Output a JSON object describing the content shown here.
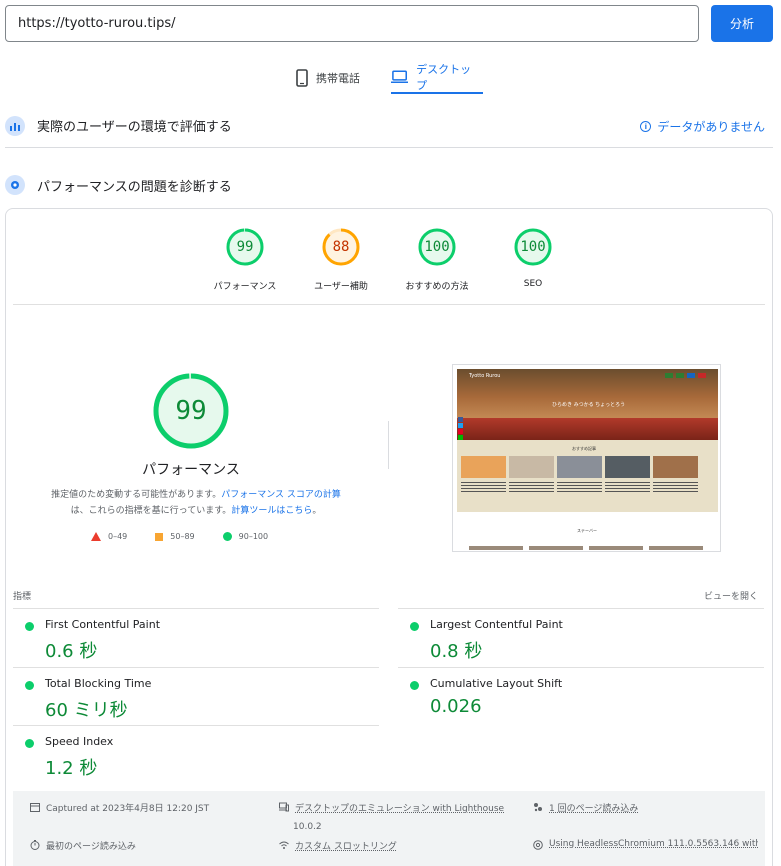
{
  "search": {
    "url": "https://tyotto-rurou.tips/",
    "analyze_label": "分析"
  },
  "tabs": {
    "mobile": "携帯電話",
    "desktop": "デスクトップ"
  },
  "field_data": {
    "title": "実際のユーザーの環境で評価する",
    "no_data": "データがありません"
  },
  "diagnose": {
    "title": "パフォーマンスの問題を診断する"
  },
  "scores": [
    {
      "label": "パフォーマンス",
      "value": "99",
      "fraction": 0.99,
      "color": "#0cce6b"
    },
    {
      "label": "ユーザー補助",
      "value": "88",
      "fraction": 0.88,
      "color": "#ffa400"
    },
    {
      "label": "おすすめの方法",
      "value": "100",
      "fraction": 1.0,
      "color": "#0cce6b"
    },
    {
      "label": "SEO",
      "value": "100",
      "fraction": 1.0,
      "color": "#0cce6b"
    }
  ],
  "performance": {
    "score": "99",
    "title": "パフォーマンス",
    "desc_1": "推定値のため変動する可能性があります。",
    "link_1": "パフォーマンス スコアの計算",
    "desc_2": "は、これらの指標を基に行っています。",
    "link_2": "計算ツールはこちら",
    "desc_3": "。"
  },
  "legend": {
    "poor": "0–49",
    "average": "50–89",
    "good": "90–100"
  },
  "thumbnail": {
    "site_title": "Tyotto Rurou",
    "tagline": "ひらめき みつかる ちょっとろう",
    "recommend": "おすすめ記事",
    "sidebar": "ステーバー"
  },
  "metrics": {
    "label": "指標",
    "view_open": "ビューを開く",
    "fcp": {
      "name": "First Contentful Paint",
      "value": "0.6 秒"
    },
    "lcp": {
      "name": "Largest Contentful Paint",
      "value": "0.8 秒"
    },
    "tbt": {
      "name": "Total Blocking Time",
      "value": "60 ミリ秒"
    },
    "cls": {
      "name": "Cumulative Layout Shift",
      "value": "0.026"
    },
    "si": {
      "name": "Speed Index",
      "value": "1.2 秒"
    }
  },
  "footer": {
    "captured": "Captured at 2023年4月8日 12:20 JST",
    "emulation": "デスクトップのエミュレーション with Lighthouse",
    "emulation_version": "10.0.2",
    "page_load": "1 回のページ読み込み",
    "first_load": "最初のページ読み込み",
    "throttling": "カスタム スロットリング",
    "browser": "Using HeadlessChromium 111.0.5563.146 with lr"
  }
}
